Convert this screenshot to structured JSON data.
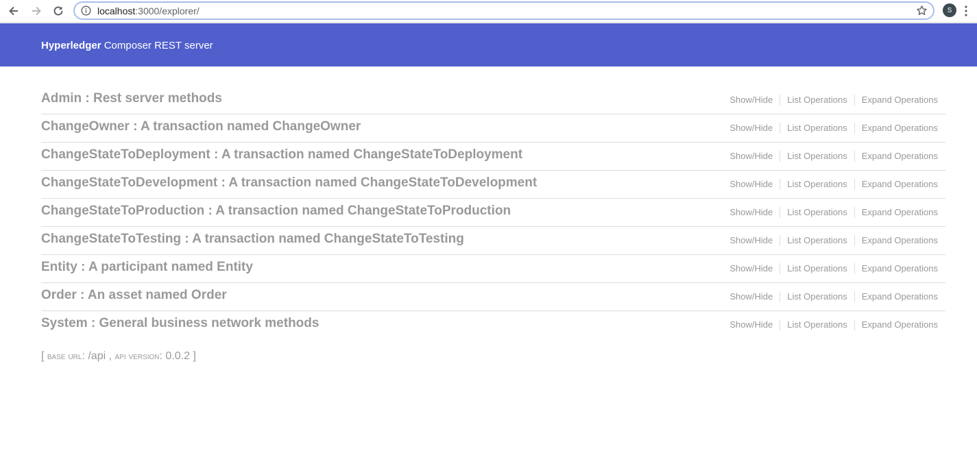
{
  "browser": {
    "url_host": "localhost",
    "url_path": ":3000/explorer/",
    "avatar_letter": "S"
  },
  "header": {
    "brand": "Hyperledger",
    "title_rest": " Composer REST server"
  },
  "operations_labels": {
    "show_hide": "Show/Hide",
    "list": "List Operations",
    "expand": "Expand Operations"
  },
  "resources": [
    {
      "title": "Admin : Rest server methods"
    },
    {
      "title": "ChangeOwner : A transaction named ChangeOwner"
    },
    {
      "title": "ChangeStateToDeployment : A transaction named ChangeStateToDeployment"
    },
    {
      "title": "ChangeStateToDevelopment : A transaction named ChangeStateToDevelopment"
    },
    {
      "title": "ChangeStateToProduction : A transaction named ChangeStateToProduction"
    },
    {
      "title": "ChangeStateToTesting : A transaction named ChangeStateToTesting"
    },
    {
      "title": "Entity : A participant named Entity"
    },
    {
      "title": "Order : An asset named Order"
    },
    {
      "title": "System : General business network methods"
    }
  ],
  "footer": {
    "open": "[ ",
    "base_url_label": "base url",
    "base_url_value": ": /api , ",
    "api_version_label": "api version",
    "api_version_value": ": 0.0.2 ]"
  },
  "colors": {
    "header_bg": "#505fcb",
    "text_gray": "#999999"
  }
}
